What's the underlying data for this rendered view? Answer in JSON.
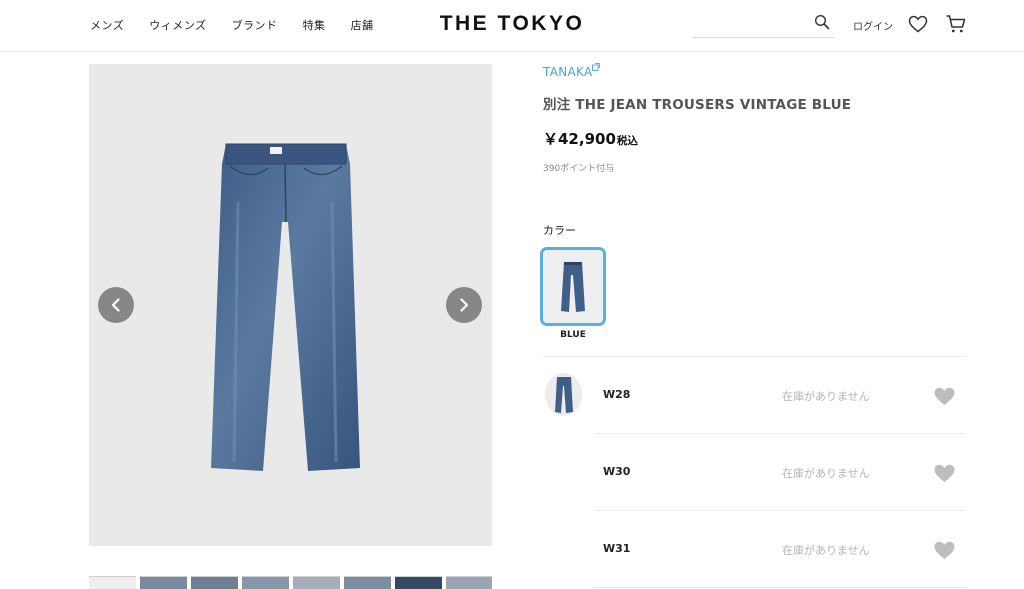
{
  "header": {
    "nav": [
      "メンズ",
      "ウィメンズ",
      "ブランド",
      "特集",
      "店舗"
    ],
    "logo": "THE TOKYO",
    "login": "ログイン",
    "icons": [
      "search-icon",
      "heart-icon",
      "cart-icon"
    ]
  },
  "product": {
    "brand": "TANAKA",
    "title": "別注 THE JEAN TROUSERS VINTAGE BLUE",
    "price": "￥42,900",
    "price_tax": "税込",
    "points": "390ポイント付与",
    "color_label": "カラー",
    "colors": [
      {
        "name": "BLUE",
        "selected": true
      }
    ],
    "sizes": [
      {
        "name": "W28",
        "stock": "在庫がありません"
      },
      {
        "name": "W30",
        "stock": "在庫がありません"
      },
      {
        "name": "W31",
        "stock": "在庫がありません"
      }
    ]
  },
  "gallery": {
    "thumbnail_count": 8,
    "prev_icon": "chevron-left-icon",
    "next_icon": "chevron-right-icon"
  },
  "colors": {
    "accent": "#5ab0dd",
    "brand_link": "#4aa0d6",
    "image_bg": "#e9e9e9",
    "arrow_bg": "#878787",
    "stock_text": "#b4b4b4",
    "fav_heart": "#bdbdbd"
  }
}
